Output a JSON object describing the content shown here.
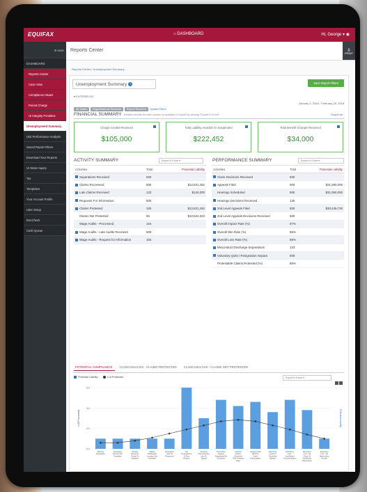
{
  "topbar": {
    "logo": "EQUIFAX",
    "center": "DASHBOARD",
    "user": "Hi, George"
  },
  "sidebar": {
    "hide_label": "HIDE",
    "items": [
      {
        "label": "DASHBOARD",
        "style": "group"
      },
      {
        "label": "Reports Center",
        "style": "sub"
      },
      {
        "label": "Case View",
        "style": "sub"
      },
      {
        "label": "Compliance Issues",
        "style": "sub"
      },
      {
        "label": "Period Charge",
        "style": "sub"
      },
      {
        "label": "UI Integrity Penalties",
        "style": "sub"
      },
      {
        "label": "Unemployment Summary",
        "style": "active"
      },
      {
        "label": "Unit Performance Analysis",
        "style": "group"
      },
      {
        "label": "Saved Report Filters",
        "style": "group"
      },
      {
        "label": "Download Your Reports",
        "style": "group"
      },
      {
        "label": "UI State Inquiry",
        "style": "group"
      },
      {
        "label": "Tax",
        "style": "group"
      },
      {
        "label": "Templates",
        "style": "group"
      },
      {
        "label": "Your Account Profile",
        "style": "group"
      },
      {
        "label": "User Setup",
        "style": "group"
      },
      {
        "label": "DocCheck",
        "style": "group"
      },
      {
        "label": "Cash Queue",
        "style": "group"
      }
    ]
  },
  "header": {
    "title": "Reports Center",
    "print_label": "PRINT"
  },
  "breadcrumb": "Reports Center  /  Unemployment Summary",
  "report": {
    "title": "Unemployment Summary",
    "save_button": "Save Report Filters",
    "filtered_label": "▾ FILTERED BY",
    "chips": [
      "All States",
      "Organizational Structure",
      "Report Structure"
    ],
    "update_filters": "Update Filters",
    "date_range": "January 1, 2018 - February 28, 2018"
  },
  "financial": {
    "title": "FINANCIAL SUMMARY",
    "note": "Detailed results for each section is available to export by clicking \"Export to Excel\"",
    "export_all": "Export all",
    "boxes": [
      {
        "label": "Charge Credits Received",
        "value": "$105,000"
      },
      {
        "label": "Total Liability Avoided Or Suspended",
        "value": "$222,452"
      },
      {
        "label": "Total Benefit Charges Received",
        "value": "$34,000"
      }
    ]
  },
  "activity": {
    "title": "ACTIVITY SUMMARY",
    "export": "Export to Excel",
    "headers": [
      "Activities",
      "Total",
      "Potential Liability"
    ],
    "rows": [
      {
        "label": "Separations Received",
        "total": "500",
        "liability": "",
        "check": true,
        "hl": true
      },
      {
        "label": "Claims Processed",
        "total": "500",
        "liability": "$12,821,452",
        "check": true,
        "hl": false
      },
      {
        "label": "Late Claims Received",
        "total": "123",
        "liability": "$134,000",
        "check": true,
        "hl": true
      },
      {
        "label": "Requests For Information",
        "total": "500",
        "liability": "",
        "check": true,
        "hl": false
      },
      {
        "label": "Claims Protested",
        "total": "105",
        "liability": "$12,821,452",
        "check": true,
        "hl": true
      },
      {
        "label": "Claims Not Protested",
        "total": "65",
        "liability": "$10,522,323",
        "check": false,
        "hl": false
      },
      {
        "label": "Wage Audits - Processed",
        "total": "154",
        "liability": "",
        "check": false,
        "hl": true
      },
      {
        "label": "Wage Audits - Late Audits Received",
        "total": "500",
        "liability": "",
        "check": true,
        "hl": false
      },
      {
        "label": "Wage Audits - Request for Information",
        "total": "154",
        "liability": "",
        "check": true,
        "hl": true
      }
    ]
  },
  "performance": {
    "title": "PERFORMANCE SUMMARY",
    "export": "Export to Excel",
    "headers": [
      "Activities",
      "Total",
      "Potential Liability"
    ],
    "rows": [
      {
        "label": "Claim Decisions Received",
        "total": "500",
        "liability": "",
        "check": true,
        "hl": true
      },
      {
        "label": "Appeals Filed",
        "total": "500",
        "liability": "$31,050,000",
        "check": true,
        "hl": false
      },
      {
        "label": "Hearings Scheduled",
        "total": "500",
        "liability": "$31,050,000",
        "check": false,
        "hl": true
      },
      {
        "label": "Hearings Decisions Received",
        "total": "125",
        "liability": "",
        "check": true,
        "hl": false
      },
      {
        "label": "2nd Level Appeals Filed",
        "total": "500",
        "liability": "$30,436,729",
        "check": true,
        "hl": true
      },
      {
        "label": "2nd Level Appeals Decisions Received",
        "total": "500",
        "liability": "",
        "check": true,
        "hl": false
      },
      {
        "label": "Overall Impact Rate (%)",
        "total": "97%",
        "liability": "",
        "check": true,
        "hl": true
      },
      {
        "label": "Overall Win Rate (%)",
        "total": "85%",
        "liability": "",
        "check": true,
        "hl": false
      },
      {
        "label": "Overall Loss Rate (%)",
        "total": "85%",
        "liability": "",
        "check": true,
        "hl": true
      },
      {
        "label": "Misconduct Discharge Separations",
        "total": "123",
        "liability": "",
        "check": true,
        "hl": false
      },
      {
        "label": "Voluntary Quits / Resignation Separa",
        "total": "500",
        "liability": "",
        "check": true,
        "hl": true
      },
      {
        "label": "Protestable Claims Protested (%)",
        "total": "85%",
        "liability": "",
        "check": false,
        "hl": false
      }
    ]
  },
  "tabs": [
    "POTENTIAL COMPLIANCE",
    "CLAIM ANALYSIS - CLAIMS PROTESTED",
    "CLAIM ANALYSIS - CLAIMS NOT PROTESTED"
  ],
  "chart_legend": {
    "series1": "Potential Liability",
    "series2": "# of Protested"
  },
  "chart_export": "Export to Excel",
  "colors": {
    "brand": "#a3183b",
    "bar": "#5b9fe0",
    "green": "#3a8d36"
  },
  "chart_data": {
    "type": "bar",
    "categories": [
      "Missing Separation",
      "Separation Record Not Available",
      "Did Not Respond Timely To Request",
      "Mailed Notification Location Not Available",
      "Separation Lack Of Response",
      "Not Protested As To Non Reason",
      "Decision Received Too Late To Appeal",
      "No Further Appeal Requested By Employer",
      "Hearing Notice Received With Hearing Date",
      "Hearing Held With No Client Participation",
      "Wavering Lost For Technical Reason",
      "Decisions Lost - Insufficient Documentation",
      "Decisions Lost - No Proof Of Deliberate Misconduct",
      "Decisions Lost - No Misconduct Proven"
    ],
    "series": [
      {
        "name": "Potential Liability",
        "values": [
          1,
          1,
          1,
          1,
          1,
          6,
          3,
          4.8,
          4.2,
          4.6,
          3.6,
          4.8,
          3.8,
          1
        ]
      },
      {
        "name": "# of Protested",
        "values": [
          0.6,
          0.6,
          0.8,
          1.1,
          1.5,
          1.9,
          2.3,
          2.7,
          2.85,
          2.7,
          2.3,
          1.9,
          1.4,
          1.0
        ]
      }
    ],
    "ylim": [
      0,
      6
    ],
    "ylabel": "# Of Processed",
    "y2label": "Potential Liability"
  }
}
